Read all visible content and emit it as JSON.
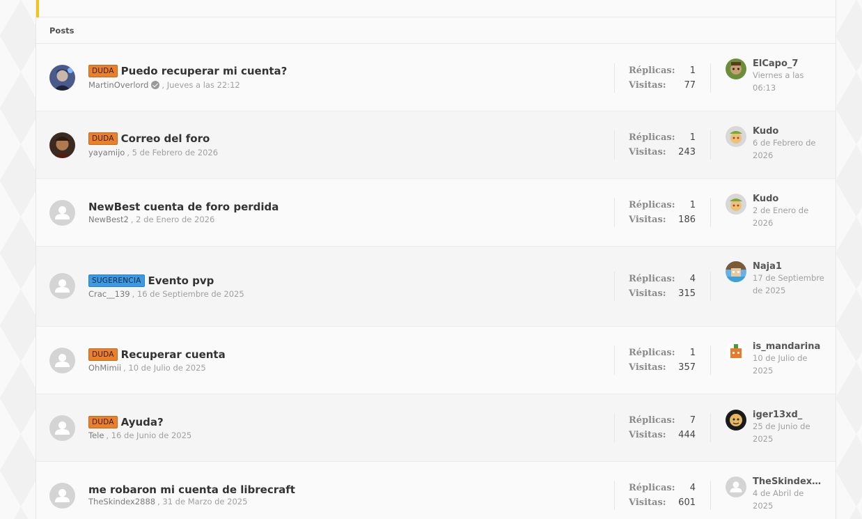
{
  "section": {
    "title": "Posts"
  },
  "labels": {
    "replies": "Réplicas:",
    "views": "Visitas:"
  },
  "colors": {
    "accent": "#f0c419",
    "duda": "#e8802c",
    "sugerencia": "#3b9ae1"
  },
  "topics": [
    {
      "badge": "DUDA",
      "title": "Puedo recuperar mi cuenta?",
      "author": "MartinOverlord",
      "date": ", Jueves a las 22:12",
      "replies": "1",
      "views": "77",
      "last_user": "ElCapo_7",
      "last_date": "Viernes a las 06:13"
    },
    {
      "badge": "DUDA",
      "title": "Correo del foro",
      "author": "yayamijo",
      "date": ", 5 de Febrero de 2026",
      "replies": "1",
      "views": "243",
      "last_user": "Kudo",
      "last_date": "6 de Febrero de 2026"
    },
    {
      "badge": "",
      "title": "NewBest cuenta de foro perdida",
      "author": "NewBest2",
      "date": ", 2 de Enero de 2026",
      "replies": "1",
      "views": "186",
      "last_user": "Kudo",
      "last_date": "2 de Enero de 2026"
    },
    {
      "badge": "SUGERENCIA",
      "title": "Evento pvp",
      "author": "Crac__139",
      "date": ", 16 de Septiembre de 2025",
      "replies": "4",
      "views": "315",
      "last_user": "Naja1",
      "last_date": "17 de Septiembre de 2025"
    },
    {
      "badge": "DUDA",
      "title": "Recuperar cuenta",
      "author": "OhMimii",
      "date": ", 10 de Julio de 2025",
      "replies": "1",
      "views": "357",
      "last_user": "is_mandarina",
      "last_date": "10 de Julio de 2025"
    },
    {
      "badge": "DUDA",
      "title": "Ayuda?",
      "author": "Tele",
      "date": ", 16 de Junio de 2025",
      "replies": "7",
      "views": "444",
      "last_user": "iger13xd_",
      "last_date": "25 de Junio de 2025"
    },
    {
      "badge": "",
      "title": "me robaron mi cuenta de librecraft",
      "author": "TheSkindex2888",
      "date": ", 31 de Marzo de 2025",
      "replies": "4",
      "views": "601",
      "last_user": "TheSkindex…",
      "last_date": "4 de Abril de 2025"
    }
  ]
}
